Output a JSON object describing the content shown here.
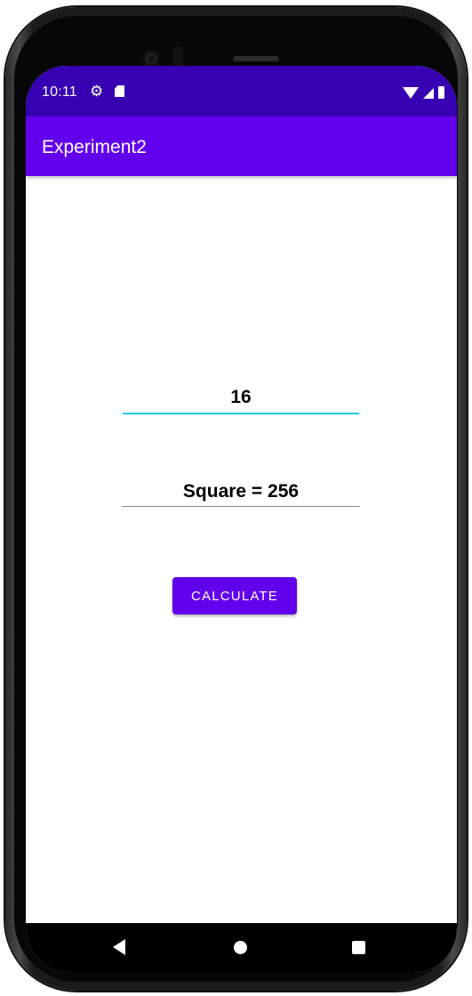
{
  "status_bar": {
    "time": "10:11",
    "icons_left": [
      "gear-icon",
      "sd-card-icon"
    ],
    "icons_right": [
      "wifi-icon",
      "signal-icon",
      "battery-icon"
    ],
    "color": "#3700b3"
  },
  "app_bar": {
    "title": "Experiment2",
    "color": "#6200ee"
  },
  "number_input": {
    "value": "16",
    "underline_color": "#26c6da"
  },
  "result": {
    "text": "Square = 256"
  },
  "calculate_button": {
    "label": "CALCULATE",
    "color": "#6200ee"
  },
  "nav_bar": {
    "buttons": [
      "back-icon",
      "home-icon",
      "recents-icon"
    ]
  }
}
